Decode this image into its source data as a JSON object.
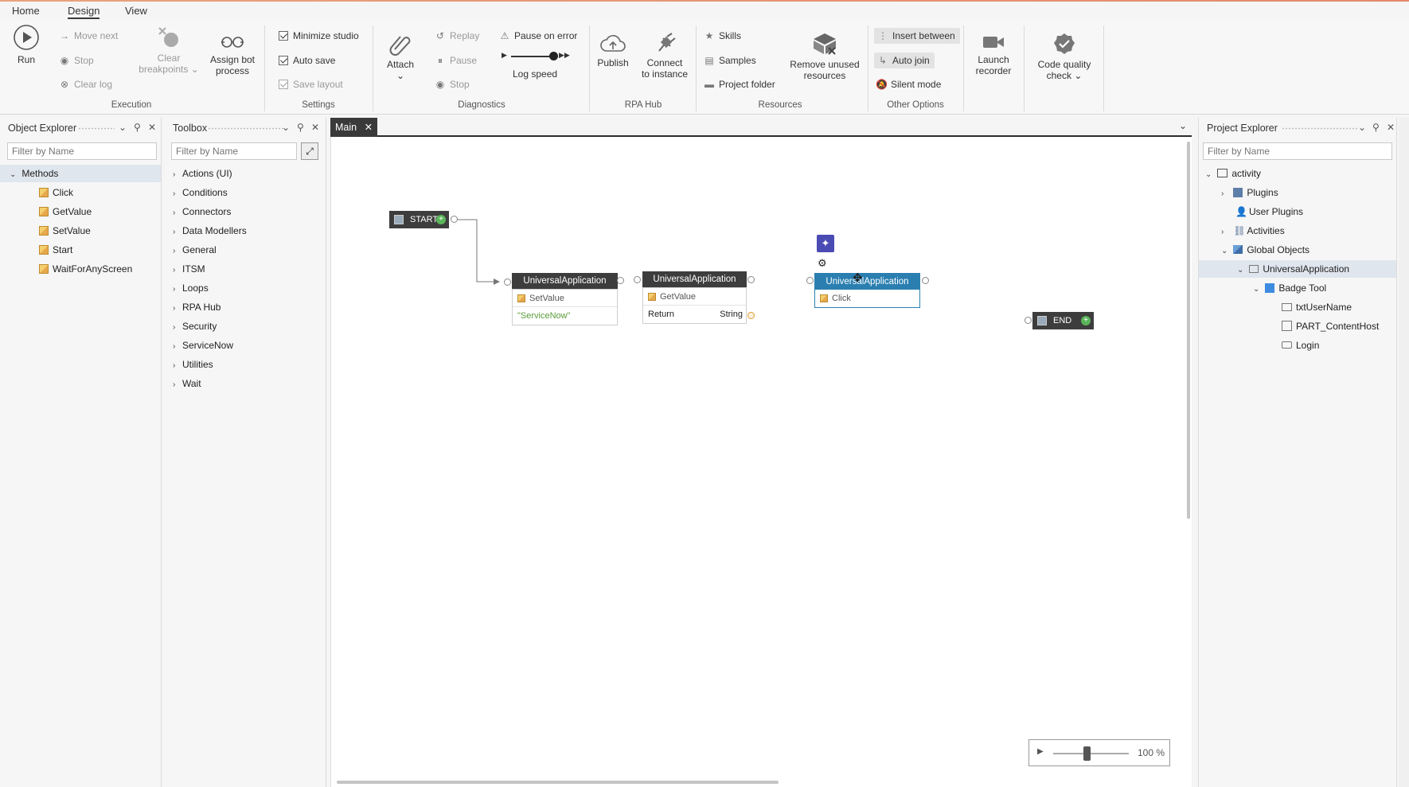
{
  "menu": {
    "tabs": [
      "Home",
      "Design",
      "View"
    ],
    "active": "Design"
  },
  "ribbon": {
    "execution": {
      "label": "Execution",
      "run": "Run",
      "move_next": "Move next",
      "stop": "Stop",
      "clear_log": "Clear log",
      "clear_breakpoints_1": "Clear",
      "clear_breakpoints_2": "breakpoints",
      "assign_1": "Assign bot",
      "assign_2": "process"
    },
    "settings": {
      "label": "Settings",
      "minimize_studio": "Minimize studio",
      "auto_save": "Auto save",
      "save_layout": "Save layout"
    },
    "diagnostics": {
      "label": "Diagnostics",
      "attach": "Attach",
      "replay": "Replay",
      "pause": "Pause",
      "stop": "Stop",
      "pause_on_error": "Pause on error",
      "log_speed": "Log speed"
    },
    "rpa_hub": {
      "label": "RPA Hub",
      "publish": "Publish",
      "connect_1": "Connect",
      "connect_2": "to instance"
    },
    "resources": {
      "label": "Resources",
      "skills": "Skills",
      "samples": "Samples",
      "project_folder": "Project folder",
      "remove_1": "Remove unused",
      "remove_2": "resources"
    },
    "other": {
      "label": "Other Options",
      "insert_between": "Insert between",
      "auto_join": "Auto join",
      "silent_mode": "Silent mode",
      "launch_1": "Launch",
      "launch_2": "recorder",
      "code_quality_1": "Code quality",
      "code_quality_2": "check"
    }
  },
  "object_explorer": {
    "title": "Object Explorer",
    "filter_placeholder": "Filter by Name",
    "root": "Methods",
    "items": [
      "Click",
      "GetValue",
      "SetValue",
      "Start",
      "WaitForAnyScreen"
    ]
  },
  "toolbox": {
    "title": "Toolbox",
    "filter_placeholder": "Filter by Name",
    "items": [
      "Actions (UI)",
      "Conditions",
      "Connectors",
      "Data Modellers",
      "General",
      "ITSM",
      "Loops",
      "RPA Hub",
      "Security",
      "ServiceNow",
      "Utilities",
      "Wait"
    ]
  },
  "canvas": {
    "tab": "Main",
    "start": "START",
    "end": "END",
    "node1": {
      "title": "UniversalApplication",
      "method": "SetValue",
      "arg": "\"ServiceNow\""
    },
    "node2": {
      "title": "UniversalApplication",
      "method": "GetValue",
      "ret_label": "Return",
      "ret_type": "String"
    },
    "node3": {
      "title": "UniversalApplication",
      "method": "Click"
    },
    "zoom": "100 %"
  },
  "project_explorer": {
    "title": "Project Explorer",
    "filter_placeholder": "Filter by Name",
    "items": {
      "activity": "activity",
      "plugins": "Plugins",
      "user_plugins": "User Plugins",
      "activities": "Activities",
      "global_objects": "Global Objects",
      "universal_app": "UniversalApplication",
      "badge_tool": "Badge Tool",
      "txt_user_name": "txtUserName",
      "part_content_host": "PART_ContentHost",
      "login": "Login"
    }
  }
}
